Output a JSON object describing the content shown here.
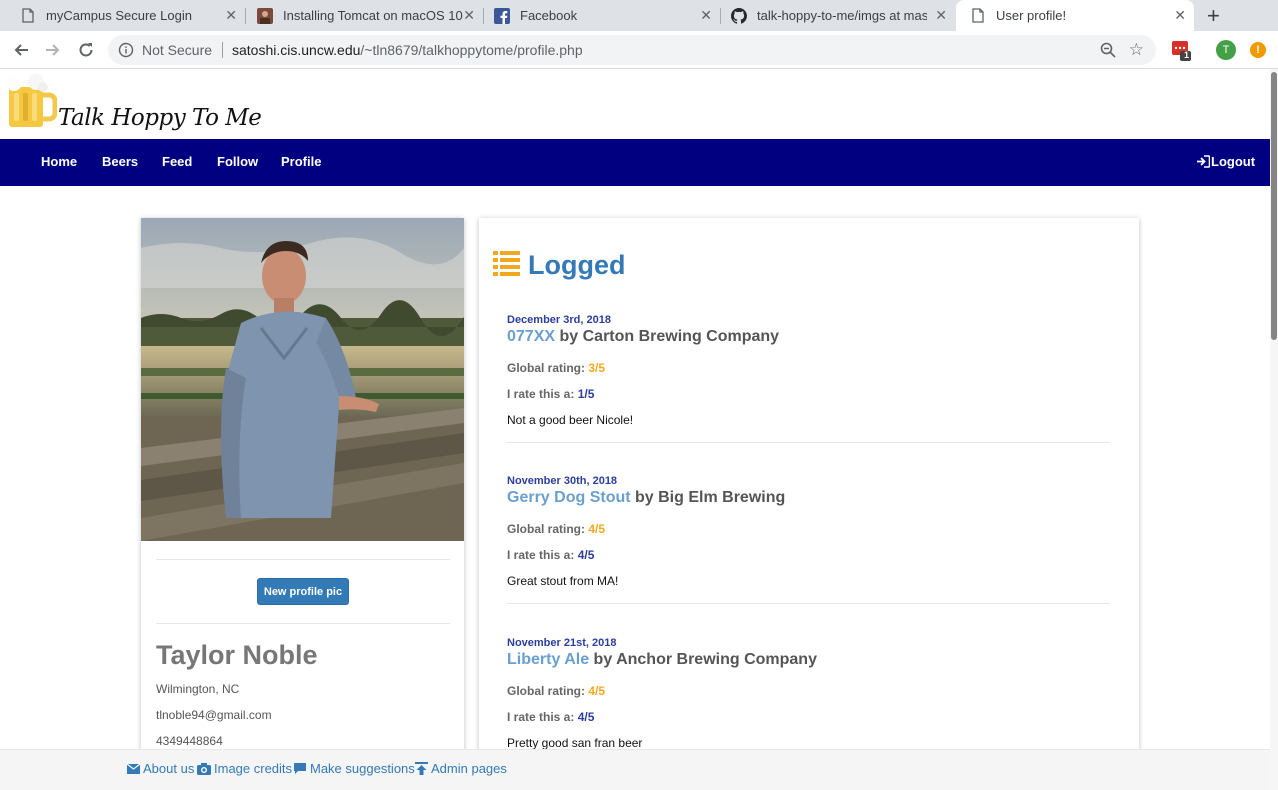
{
  "browser": {
    "tabs": [
      {
        "title": "myCampus Secure Login",
        "icon": "page-icon"
      },
      {
        "title": "Installing Tomcat on macOS 10",
        "icon": "photo-favicon"
      },
      {
        "title": "Facebook",
        "icon": "facebook-icon"
      },
      {
        "title": "talk-hoppy-to-me/imgs at mas",
        "icon": "github-icon"
      },
      {
        "title": "User profile!",
        "icon": "page-icon"
      }
    ],
    "security_label": "Not Secure",
    "url_host": "satoshi.cis.uncw.edu",
    "url_path": "/~tln8679/talkhoppytome/profile.php",
    "extension_badge": "1",
    "profile_initial": "T"
  },
  "site": {
    "title": "Talk Hoppy To Me"
  },
  "nav": {
    "items": [
      "Home",
      "Beers",
      "Feed",
      "Follow",
      "Profile"
    ],
    "logout": "Logout"
  },
  "profile": {
    "button": "New profile pic",
    "name": "Taylor Noble",
    "location": "Wilmington, NC",
    "email": "tlnoble94@gmail.com",
    "phone": "4349448864"
  },
  "logged": {
    "title": "Logged",
    "global_label": "Global rating:",
    "mine_label": "I rate this a:",
    "entries": [
      {
        "date": "December 3rd, 2018",
        "beer": "077XX",
        "brewery": " by Carton Brewing Company",
        "global": "3/5",
        "mine": "1/5",
        "comment": "Not a good beer Nicole!"
      },
      {
        "date": "November 30th, 2018",
        "beer": "Gerry Dog Stout",
        "brewery": " by Big Elm Brewing",
        "global": "4/5",
        "mine": "4/5",
        "comment": "Great stout from MA!"
      },
      {
        "date": "November 21st, 2018",
        "beer": "Liberty Ale",
        "brewery": " by Anchor Brewing Company",
        "global": "4/5",
        "mine": "4/5",
        "comment": "Pretty good san fran beer"
      }
    ]
  },
  "footer": {
    "links": [
      "About us",
      "Image credits",
      "Make suggestions",
      "Admin pages"
    ]
  },
  "colors": {
    "nav_bg": "#000080",
    "link_blue": "#337ab7",
    "rating_gold": "#f0a91e",
    "rating_navy": "#2c3e9e"
  }
}
